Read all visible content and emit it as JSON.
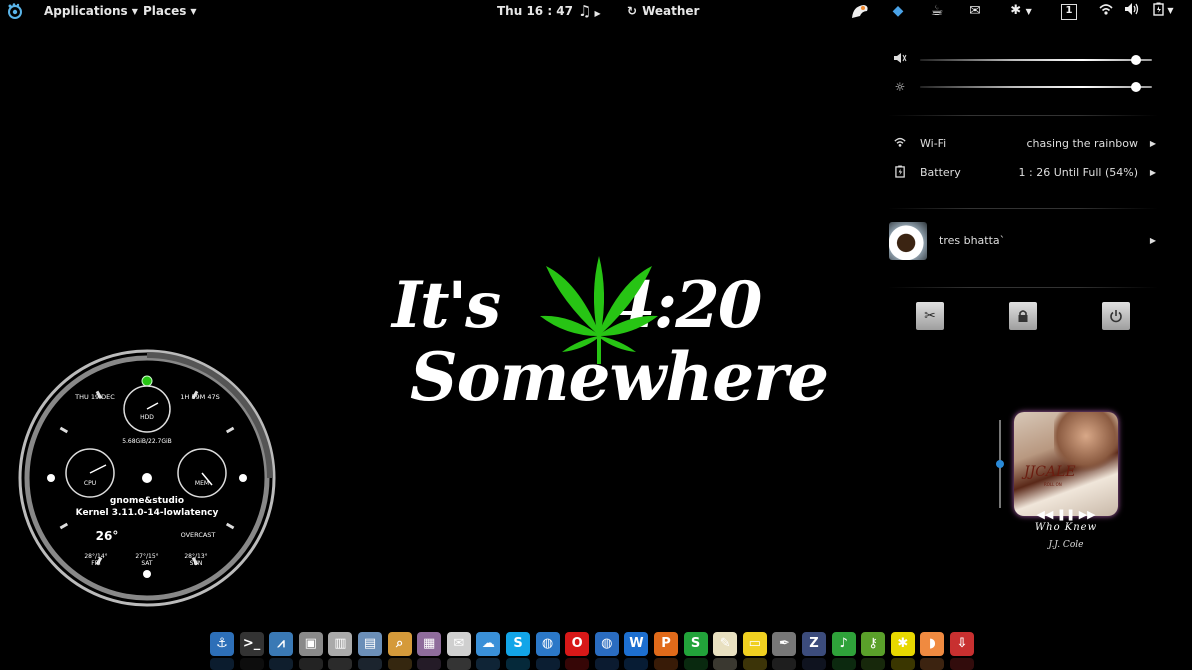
{
  "topbar": {
    "activities_icon": "gnome-foot-icon",
    "applications_label": "Applications",
    "places_label": "Places",
    "clock": "Thu 16 : 47",
    "music_icon": "music-note-icon",
    "weather_label": "Weather",
    "tray_icons": [
      "pidgin-icon",
      "dropbox-icon",
      "cup-icon",
      "mail-icon",
      "accessibility-icon",
      "workspace-indicator-icon",
      "wifi-icon",
      "volume-icon",
      "battery-icon"
    ],
    "workspace_number": "1"
  },
  "status_menu": {
    "volume_level": 0.93,
    "brightness_level": 0.93,
    "wifi_label": "Wi-Fi",
    "wifi_network": "chasing the rainbow",
    "battery_label": "Battery",
    "battery_status": "1 : 26 Until Full (54%)",
    "user_name": "tres bhatta`",
    "buttons": [
      "settings-icon",
      "lock-icon",
      "power-icon"
    ]
  },
  "wallpaper": {
    "line1_a": "It's",
    "line1_b": "4:20",
    "line2": "Somewhere",
    "leaf_color": "#27c414"
  },
  "clock_widget": {
    "date": "THU 19 DEC",
    "uptime": "1H 59M 47S",
    "hdd_label": "HDD",
    "hdd_usage": "5.68GiB/22.7GiB",
    "cpu_label": "CPU",
    "mem_label": "MEM",
    "host": "gnome&studio",
    "kernel": "Kernel 3.11.0-14-lowlatency",
    "temperature": "26°",
    "condition": "OVERCAST",
    "forecast": [
      {
        "temp": "28°/14°",
        "day": "FRI"
      },
      {
        "temp": "27°/15°",
        "day": "SAT"
      },
      {
        "temp": "28°/13°",
        "day": "SUN"
      }
    ]
  },
  "music_widget": {
    "album_artist_text": "JJCALE",
    "album_sub_text": "ROLL ON",
    "track": "Who Knew",
    "artist": "J.J. Cole",
    "volume_level": 0.5
  },
  "dock": {
    "items": [
      {
        "name": "anchor-icon",
        "glyph": "⚓",
        "color": "#2d6fb8"
      },
      {
        "name": "terminal-icon",
        "glyph": ">_",
        "color": "#333"
      },
      {
        "name": "system-monitor-icon",
        "glyph": "⩘",
        "color": "#3a79b5"
      },
      {
        "name": "package-icon",
        "glyph": "▣",
        "color": "#8a8a8a"
      },
      {
        "name": "audio-mixer-icon",
        "glyph": "▥",
        "color": "#aaaaaa"
      },
      {
        "name": "file-manager-icon",
        "glyph": "▤",
        "color": "#6b8fb8"
      },
      {
        "name": "search-tool-icon",
        "glyph": "⌕",
        "color": "#d59a3a"
      },
      {
        "name": "photo-viewer-icon",
        "glyph": "▦",
        "color": "#8f6c9c"
      },
      {
        "name": "mail-client-icon",
        "glyph": "✉",
        "color": "#cfcfcf"
      },
      {
        "name": "chat-icon",
        "glyph": "☁",
        "color": "#3a90d8"
      },
      {
        "name": "skype-icon",
        "glyph": "S",
        "color": "#12a5e8"
      },
      {
        "name": "globe-icon",
        "glyph": "◍",
        "color": "#2b78c8"
      },
      {
        "name": "opera-icon",
        "glyph": "O",
        "color": "#d81818"
      },
      {
        "name": "browser-icon",
        "glyph": "◍",
        "color": "#2a6cc0"
      },
      {
        "name": "wps-writer-icon",
        "glyph": "W",
        "color": "#1d6fd0"
      },
      {
        "name": "wps-presentation-icon",
        "glyph": "P",
        "color": "#e06a1a"
      },
      {
        "name": "wps-spreadsheet-icon",
        "glyph": "S",
        "color": "#22a33a"
      },
      {
        "name": "text-editor-icon",
        "glyph": "✎",
        "color": "#e8e0c0"
      },
      {
        "name": "sticky-notes-icon",
        "glyph": "▭",
        "color": "#f0d020"
      },
      {
        "name": "pen-tool-icon",
        "glyph": "✒",
        "color": "#777"
      },
      {
        "name": "zyn-jack-icon",
        "glyph": "Z",
        "color": "#3c4c7c"
      },
      {
        "name": "music-player-icon",
        "glyph": "♪",
        "color": "#2fa23a"
      },
      {
        "name": "key-icon",
        "glyph": "⚷",
        "color": "#5aa02a"
      },
      {
        "name": "bug-icon",
        "glyph": "✱",
        "color": "#e8d800"
      },
      {
        "name": "melon-icon",
        "glyph": "◗",
        "color": "#f08a40"
      },
      {
        "name": "installer-icon",
        "glyph": "⇩",
        "color": "#c83030"
      }
    ]
  }
}
